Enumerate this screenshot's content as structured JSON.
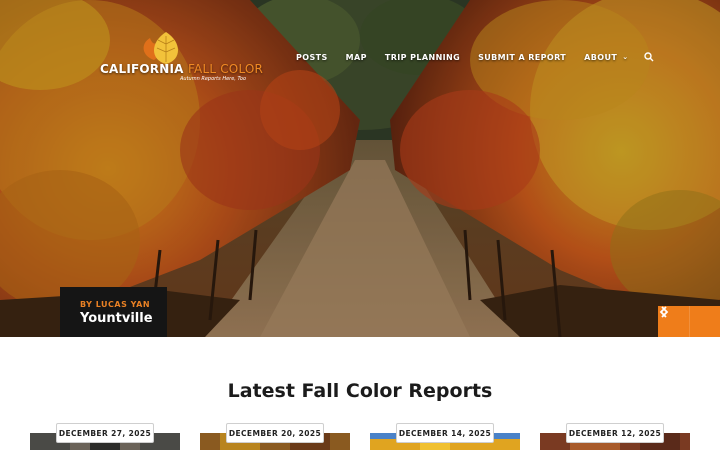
{
  "site": {
    "logo_word1": "CALIFORNIA",
    "logo_word2": "FALL COLOR",
    "tagline": "Autumn Reports Here, Too",
    "colors": {
      "accent": "#ef7d1a",
      "dark": "#151515"
    }
  },
  "nav": {
    "items": [
      "POSTS",
      "MAP",
      "TRIP PLANNING",
      "SUBMIT A REPORT",
      "ABOUT"
    ],
    "about_icon": "chevron-down-icon",
    "search_icon": "search-icon"
  },
  "hero": {
    "byline": "BY LUCAS YAN",
    "title": "Yountville",
    "prev_icon": "chevron-left-icon",
    "next_icon": "chevron-right-icon"
  },
  "reports": {
    "heading": "Latest Fall Color Reports",
    "cards": [
      {
        "date": "DECEMBER 27, 2025"
      },
      {
        "date": "DECEMBER 20, 2025"
      },
      {
        "date": "DECEMBER 14, 2025"
      },
      {
        "date": "DECEMBER 12, 2025"
      }
    ]
  }
}
